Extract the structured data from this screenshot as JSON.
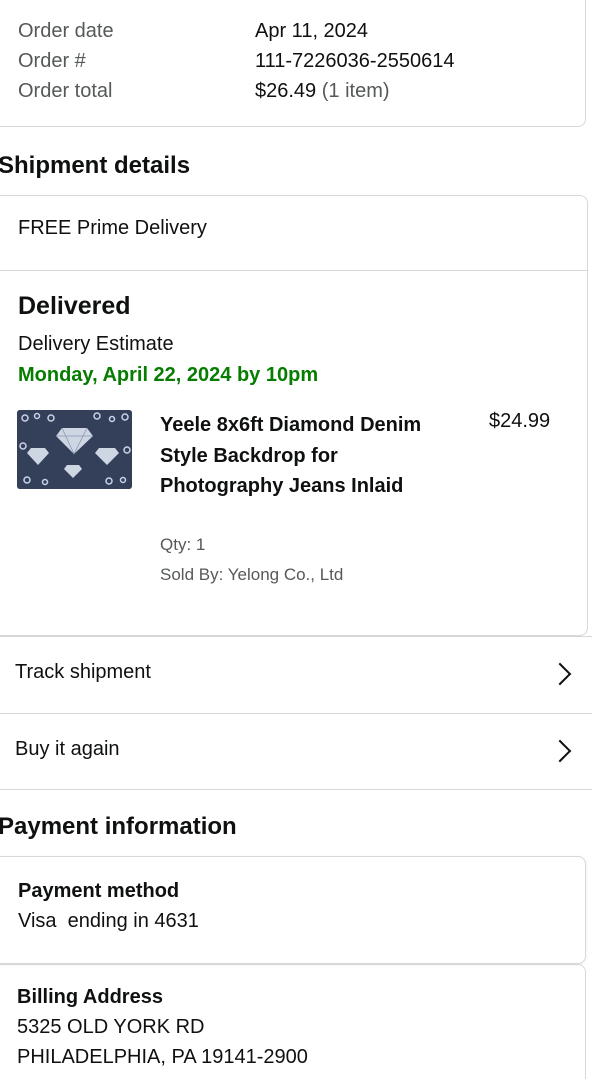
{
  "order_summary": {
    "order_date_label": "Order date",
    "order_date_value": "Apr 11, 2024",
    "order_number_label": "Order #",
    "order_number_value": "111-7226036-2550614",
    "order_total_label": "Order total",
    "order_total_value": "$26.49",
    "order_total_items": "(1 item)"
  },
  "shipment": {
    "section_title": "Shipment details",
    "delivery_type": "FREE Prime Delivery",
    "status": "Delivered",
    "estimate_label": "Delivery Estimate",
    "estimate_date": "Monday, April 22, 2024 by 10pm",
    "item": {
      "title": "Yeele 8x6ft Diamond Denim Style Backdrop for Photography Jeans Inlaid",
      "price": "$24.99",
      "qty": "Qty: 1",
      "sold_by": "Sold By: Yelong Co., Ltd",
      "thumbnail_icon": "product-thumbnail"
    }
  },
  "actions": {
    "track": "Track shipment",
    "buy_again": "Buy it again",
    "chevron_icon": "chevron-right-icon"
  },
  "payment": {
    "section_title": "Payment information",
    "method_label": "Payment method",
    "method_value": "Visa  ending in 4631",
    "billing_label": "Billing Address",
    "billing_line1": "5325 OLD YORK RD",
    "billing_line2": "PHILADELPHIA, PA 19141-2900"
  },
  "colors": {
    "delivery_green": "#067d00",
    "border": "#d5d9d9",
    "muted_text": "#565959"
  }
}
